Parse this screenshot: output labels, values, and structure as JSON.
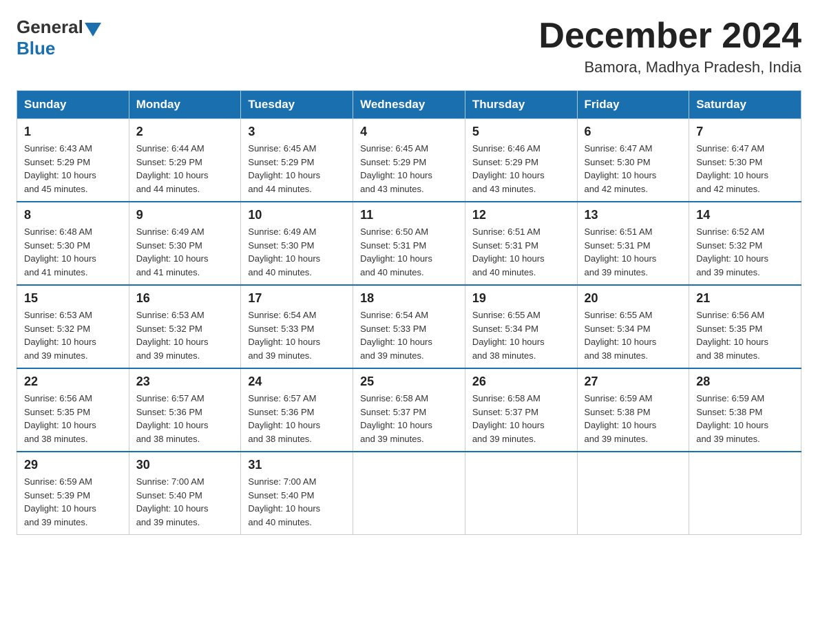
{
  "header": {
    "logo_general": "General",
    "logo_blue": "Blue",
    "month_title": "December 2024",
    "location": "Bamora, Madhya Pradesh, India"
  },
  "days_of_week": [
    "Sunday",
    "Monday",
    "Tuesday",
    "Wednesday",
    "Thursday",
    "Friday",
    "Saturday"
  ],
  "weeks": [
    [
      {
        "day": "1",
        "sunrise": "6:43 AM",
        "sunset": "5:29 PM",
        "daylight": "10 hours and 45 minutes."
      },
      {
        "day": "2",
        "sunrise": "6:44 AM",
        "sunset": "5:29 PM",
        "daylight": "10 hours and 44 minutes."
      },
      {
        "day": "3",
        "sunrise": "6:45 AM",
        "sunset": "5:29 PM",
        "daylight": "10 hours and 44 minutes."
      },
      {
        "day": "4",
        "sunrise": "6:45 AM",
        "sunset": "5:29 PM",
        "daylight": "10 hours and 43 minutes."
      },
      {
        "day": "5",
        "sunrise": "6:46 AM",
        "sunset": "5:29 PM",
        "daylight": "10 hours and 43 minutes."
      },
      {
        "day": "6",
        "sunrise": "6:47 AM",
        "sunset": "5:30 PM",
        "daylight": "10 hours and 42 minutes."
      },
      {
        "day": "7",
        "sunrise": "6:47 AM",
        "sunset": "5:30 PM",
        "daylight": "10 hours and 42 minutes."
      }
    ],
    [
      {
        "day": "8",
        "sunrise": "6:48 AM",
        "sunset": "5:30 PM",
        "daylight": "10 hours and 41 minutes."
      },
      {
        "day": "9",
        "sunrise": "6:49 AM",
        "sunset": "5:30 PM",
        "daylight": "10 hours and 41 minutes."
      },
      {
        "day": "10",
        "sunrise": "6:49 AM",
        "sunset": "5:30 PM",
        "daylight": "10 hours and 40 minutes."
      },
      {
        "day": "11",
        "sunrise": "6:50 AM",
        "sunset": "5:31 PM",
        "daylight": "10 hours and 40 minutes."
      },
      {
        "day": "12",
        "sunrise": "6:51 AM",
        "sunset": "5:31 PM",
        "daylight": "10 hours and 40 minutes."
      },
      {
        "day": "13",
        "sunrise": "6:51 AM",
        "sunset": "5:31 PM",
        "daylight": "10 hours and 39 minutes."
      },
      {
        "day": "14",
        "sunrise": "6:52 AM",
        "sunset": "5:32 PM",
        "daylight": "10 hours and 39 minutes."
      }
    ],
    [
      {
        "day": "15",
        "sunrise": "6:53 AM",
        "sunset": "5:32 PM",
        "daylight": "10 hours and 39 minutes."
      },
      {
        "day": "16",
        "sunrise": "6:53 AM",
        "sunset": "5:32 PM",
        "daylight": "10 hours and 39 minutes."
      },
      {
        "day": "17",
        "sunrise": "6:54 AM",
        "sunset": "5:33 PM",
        "daylight": "10 hours and 39 minutes."
      },
      {
        "day": "18",
        "sunrise": "6:54 AM",
        "sunset": "5:33 PM",
        "daylight": "10 hours and 39 minutes."
      },
      {
        "day": "19",
        "sunrise": "6:55 AM",
        "sunset": "5:34 PM",
        "daylight": "10 hours and 38 minutes."
      },
      {
        "day": "20",
        "sunrise": "6:55 AM",
        "sunset": "5:34 PM",
        "daylight": "10 hours and 38 minutes."
      },
      {
        "day": "21",
        "sunrise": "6:56 AM",
        "sunset": "5:35 PM",
        "daylight": "10 hours and 38 minutes."
      }
    ],
    [
      {
        "day": "22",
        "sunrise": "6:56 AM",
        "sunset": "5:35 PM",
        "daylight": "10 hours and 38 minutes."
      },
      {
        "day": "23",
        "sunrise": "6:57 AM",
        "sunset": "5:36 PM",
        "daylight": "10 hours and 38 minutes."
      },
      {
        "day": "24",
        "sunrise": "6:57 AM",
        "sunset": "5:36 PM",
        "daylight": "10 hours and 38 minutes."
      },
      {
        "day": "25",
        "sunrise": "6:58 AM",
        "sunset": "5:37 PM",
        "daylight": "10 hours and 39 minutes."
      },
      {
        "day": "26",
        "sunrise": "6:58 AM",
        "sunset": "5:37 PM",
        "daylight": "10 hours and 39 minutes."
      },
      {
        "day": "27",
        "sunrise": "6:59 AM",
        "sunset": "5:38 PM",
        "daylight": "10 hours and 39 minutes."
      },
      {
        "day": "28",
        "sunrise": "6:59 AM",
        "sunset": "5:38 PM",
        "daylight": "10 hours and 39 minutes."
      }
    ],
    [
      {
        "day": "29",
        "sunrise": "6:59 AM",
        "sunset": "5:39 PM",
        "daylight": "10 hours and 39 minutes."
      },
      {
        "day": "30",
        "sunrise": "7:00 AM",
        "sunset": "5:40 PM",
        "daylight": "10 hours and 39 minutes."
      },
      {
        "day": "31",
        "sunrise": "7:00 AM",
        "sunset": "5:40 PM",
        "daylight": "10 hours and 40 minutes."
      },
      null,
      null,
      null,
      null
    ]
  ],
  "labels": {
    "sunrise": "Sunrise:",
    "sunset": "Sunset:",
    "daylight": "Daylight:"
  }
}
